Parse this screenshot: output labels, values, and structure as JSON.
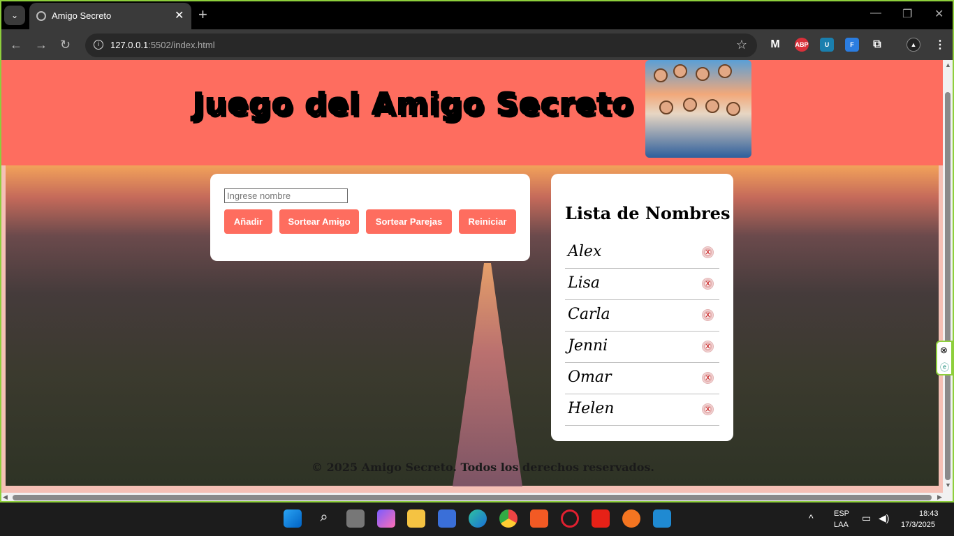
{
  "browser": {
    "tab_title": "Amigo Secreto",
    "url_host": "127.0.0.1",
    "url_rest": ":5502/index.html",
    "new_tab_label": "+",
    "close_tab_label": "✕"
  },
  "header": {
    "title": "Juego del Amigo Secreto"
  },
  "form": {
    "input_placeholder": "Ingrese nombre",
    "buttons": {
      "add": "Añadir",
      "draw_friend": "Sortear Amigo",
      "draw_pairs": "Sortear Parejas",
      "reset": "Reiniciar"
    }
  },
  "list": {
    "title": "Lista de Nombres",
    "names": [
      "Alex",
      "Lisa",
      "Carla",
      "Jenni",
      "Omar",
      "Helen"
    ],
    "remove_icon": "x"
  },
  "footer": {
    "text": "© 2025 Amigo Secreto. Todos los derechos reservados."
  },
  "taskbar": {
    "lang": "ESP",
    "layout": "LAA",
    "time": "18:43",
    "date": "17/3/2025"
  },
  "colors": {
    "accent": "#fe6d5f",
    "window_border": "#8ecf3c"
  }
}
